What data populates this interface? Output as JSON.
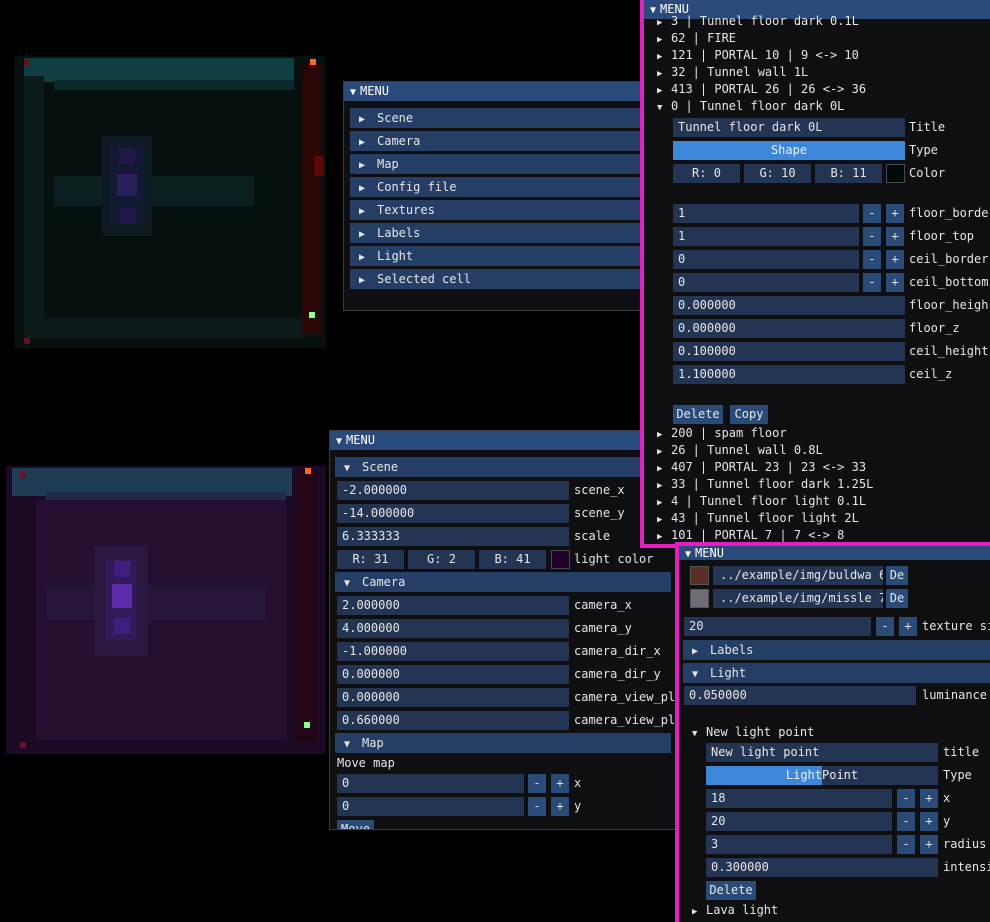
{
  "colors": {
    "accent": "#294a7a",
    "highlight_border": "#e21fc0",
    "slider_fill": "#3d86d8"
  },
  "menu_title": "MENU",
  "menu1": {
    "items": [
      "Scene",
      "Camera",
      "Map",
      "Config file",
      "Textures",
      "Labels",
      "Light",
      "Selected cell"
    ]
  },
  "menu2": {
    "scene_header": "Scene",
    "scene_fields": [
      {
        "value": "-2.000000",
        "label": "scene_x"
      },
      {
        "value": "-14.000000",
        "label": "scene_y"
      },
      {
        "value": "6.333333",
        "label": "scale"
      }
    ],
    "light_color": {
      "r": "R: 31",
      "g": "G:  2",
      "b": "B: 41",
      "label": "light color",
      "swatch": "#1f0229"
    },
    "camera_header": "Camera",
    "camera_fields": [
      {
        "value": "2.000000",
        "label": "camera_x"
      },
      {
        "value": "4.000000",
        "label": "camera_y"
      },
      {
        "value": "-1.000000",
        "label": "camera_dir_x"
      },
      {
        "value": "0.000000",
        "label": "camera_dir_y"
      },
      {
        "value": "0.000000",
        "label": "camera_view_pl"
      },
      {
        "value": "0.660000",
        "label": "camera_view_pl"
      }
    ],
    "map_header": "Map",
    "move_map_label": "Move map",
    "map_x": {
      "value": "0",
      "label": "x"
    },
    "map_y": {
      "value": "0",
      "label": "y"
    },
    "move_button": "Move",
    "minus": "-",
    "plus": "+"
  },
  "menu3": {
    "tree_top": [
      "3 | Tunnel floor dark 0.1L",
      "62 | FIRE",
      "121 | PORTAL 10 | 9 <-> 10",
      "32 | Tunnel wall 1L",
      "413 | PORTAL 26 | 26 <-> 36",
      "0 | Tunnel floor dark 0L"
    ],
    "title_value": "Tunnel floor dark 0L",
    "title_label": "Title",
    "type_value": "Shape",
    "type_label": "Type",
    "color": {
      "r": "R:  0",
      "g": "G: 10",
      "b": "B: 11",
      "label": "Color",
      "swatch": "#000a0b"
    },
    "int_fields": [
      {
        "value": "1",
        "label": "floor_borde"
      },
      {
        "value": "1",
        "label": "floor_top"
      },
      {
        "value": "0",
        "label": "ceil_border"
      },
      {
        "value": "0",
        "label": "ceil_bottom"
      }
    ],
    "float_fields": [
      {
        "value": "0.000000",
        "label": "floor_heigh"
      },
      {
        "value": "0.000000",
        "label": "floor_z"
      },
      {
        "value": "0.100000",
        "label": "ceil_height"
      },
      {
        "value": "1.100000",
        "label": "ceil_z"
      }
    ],
    "delete": "Delete",
    "copy": "Copy",
    "tree_bottom": [
      "200 | spam floor",
      "26 | Tunnel wall 0.8L",
      "407 | PORTAL 23 | 23 <-> 33",
      "33 | Tunnel floor dark 1.25L",
      "4 | Tunnel floor light 0.1L",
      "43 | Tunnel floor light 2L",
      "101 | PORTAL 7 | 7 <-> 8"
    ]
  },
  "menu4": {
    "textures": [
      {
        "path": "../example/img/buldwa 6",
        "del": "De"
      },
      {
        "path": "../example/img/missle 7",
        "del": "De"
      }
    ],
    "texture_size": {
      "value": "20",
      "label": "texture si"
    },
    "labels_header": "Labels",
    "light_header": "Light",
    "luminance": {
      "value": "0.050000",
      "label": "luminance"
    },
    "new_light_node": "New light point",
    "light_title": {
      "value": "New light point",
      "label": "title"
    },
    "light_type": {
      "value": "LightPoint",
      "label": "Type",
      "fill_fraction": 0.5
    },
    "light_x": {
      "value": "18",
      "label": "x"
    },
    "light_y": {
      "value": "20",
      "label": "y"
    },
    "light_radius": {
      "value": "3",
      "label": "radius"
    },
    "light_intensity": {
      "value": "0.300000",
      "label": "intensi"
    },
    "delete": "Delete",
    "lava_node": "Lava light"
  }
}
